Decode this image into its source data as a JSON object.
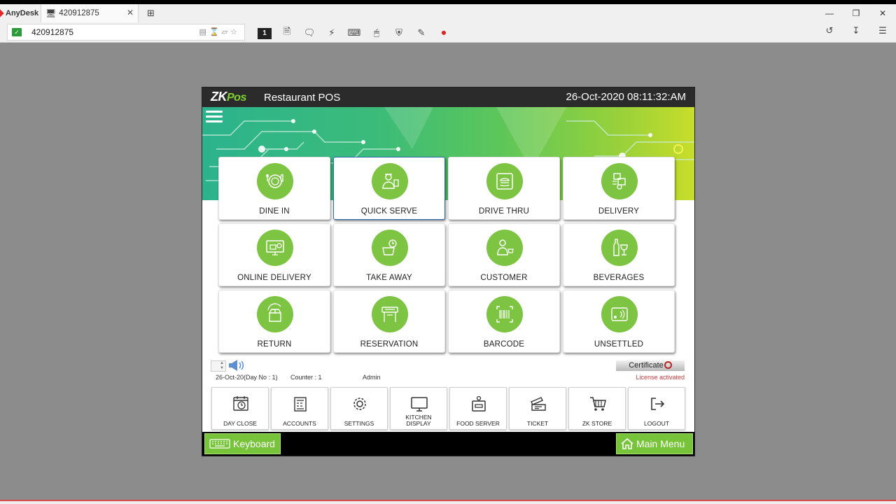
{
  "anydesk": {
    "brand": "AnyDesk",
    "tab_title": "420912875",
    "address": "420912875",
    "session_number": "1"
  },
  "pos": {
    "logo_zk": "ZK",
    "logo_pos": "Pos",
    "app_title": "Restaurant POS",
    "datetime": "26-Oct-2020 08:11:32:AM",
    "tiles": [
      {
        "label": "DINE IN",
        "icon": "dine-in-icon"
      },
      {
        "label": "QUICK SERVE",
        "icon": "quick-serve-icon"
      },
      {
        "label": "DRIVE THRU",
        "icon": "drive-thru-icon"
      },
      {
        "label": "DELIVERY",
        "icon": "delivery-icon"
      },
      {
        "label": "ONLINE DELIVERY",
        "icon": "online-delivery-icon"
      },
      {
        "label": "TAKE AWAY",
        "icon": "take-away-icon"
      },
      {
        "label": "CUSTOMER",
        "icon": "customer-icon"
      },
      {
        "label": "BEVERAGES",
        "icon": "beverages-icon"
      },
      {
        "label": "RETURN",
        "icon": "return-icon"
      },
      {
        "label": "RESERVATION",
        "icon": "reservation-icon"
      },
      {
        "label": "BARCODE",
        "icon": "barcode-icon"
      },
      {
        "label": "UNSETTLED",
        "icon": "unsettled-icon"
      }
    ],
    "status": {
      "day_info": "26-Oct-20(Day No : 1)",
      "counter": "Counter : 1",
      "user": "Admin",
      "certificate": "Certificate",
      "license": "License activated"
    },
    "actions": [
      {
        "label": "DAY CLOSE",
        "icon": "day-close-icon"
      },
      {
        "label": "ACCOUNTS",
        "icon": "accounts-icon"
      },
      {
        "label": "SETTINGS",
        "icon": "settings-icon"
      },
      {
        "label": "KITCHEN\nDISPLAY",
        "icon": "kitchen-display-icon"
      },
      {
        "label": "FOOD SERVER",
        "icon": "food-server-icon"
      },
      {
        "label": "TICKET",
        "icon": "ticket-icon"
      },
      {
        "label": "ZK STORE",
        "icon": "zk-store-icon"
      },
      {
        "label": "LOGOUT",
        "icon": "logout-icon"
      }
    ],
    "footer": {
      "keyboard": "Keyboard",
      "main_menu": "Main Menu"
    },
    "colors": {
      "accent_green": "#7cc442",
      "title_bar": "#2b2b2b",
      "license_red": "#c23a3a"
    }
  }
}
